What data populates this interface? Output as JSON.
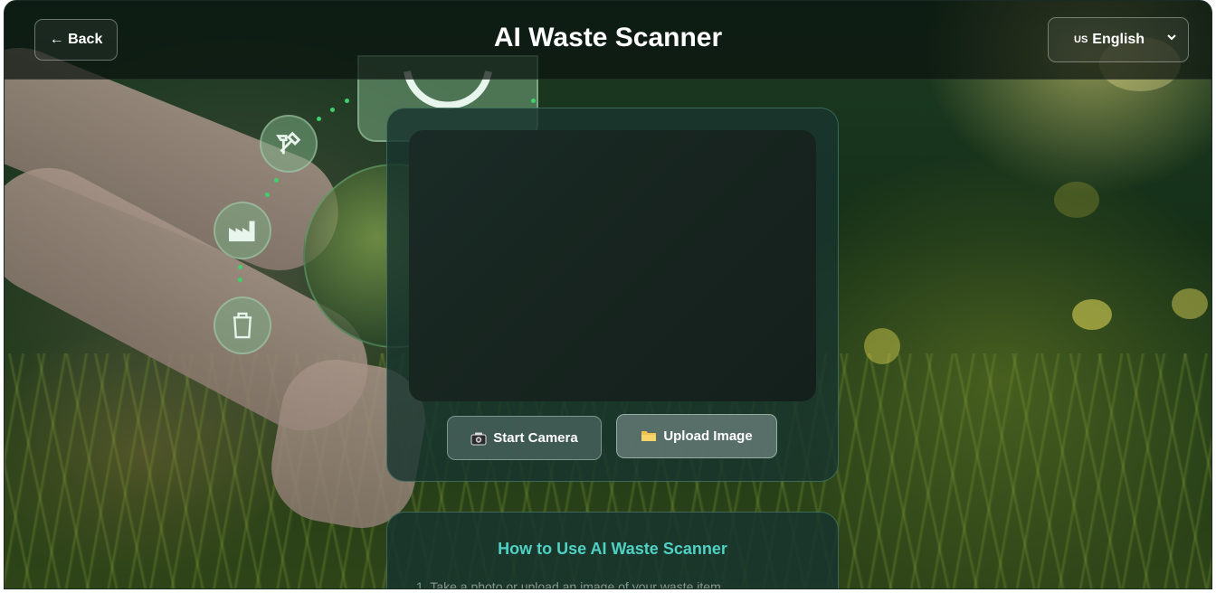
{
  "header": {
    "back_label": "← Back",
    "title": "AI Waste Scanner",
    "language": {
      "flag": "US",
      "selected": "English"
    }
  },
  "scanner": {
    "start_camera_label": "Start Camera",
    "start_camera_icon": "camera-icon",
    "upload_label": "Upload Image",
    "upload_icon": "folder-icon"
  },
  "howto": {
    "title": "How to Use AI Waste Scanner",
    "steps": [
      "1. Take a photo or upload an image of your waste item"
    ]
  },
  "colors": {
    "accent": "#4fd1c5",
    "header_bg": "#0a120e",
    "card_bg": "#18342e"
  }
}
